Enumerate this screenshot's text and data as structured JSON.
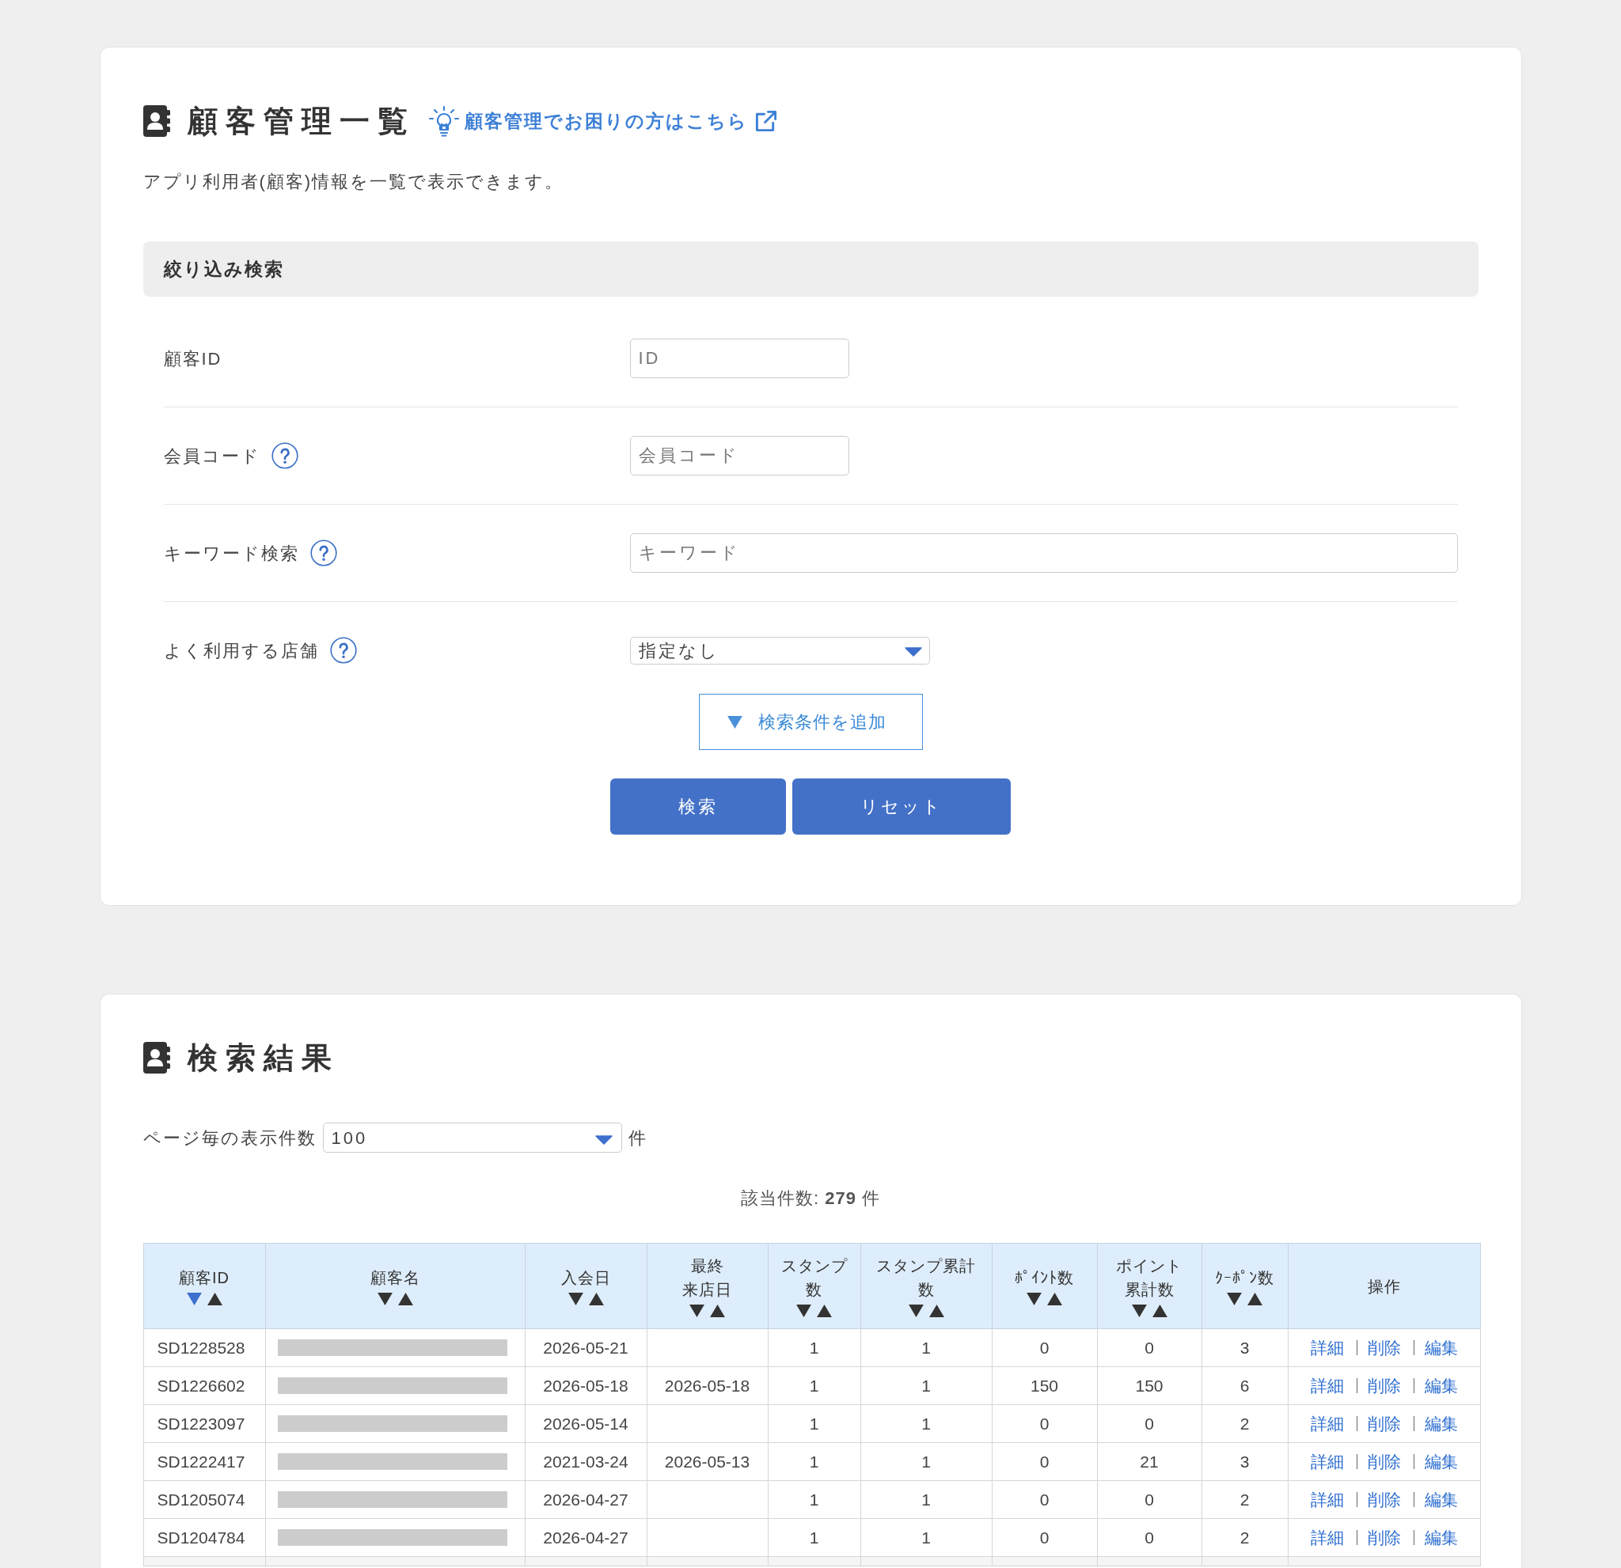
{
  "header": {
    "title": "顧客管理一覧",
    "help_link": "顧客管理でお困りの方はこちら",
    "description": "アプリ利用者(顧客)情報を一覧で表示できます。"
  },
  "filter": {
    "title": "絞り込み検索",
    "fields": [
      {
        "kind": "text",
        "label": "顧客ID",
        "placeholder": "ID",
        "help": false
      },
      {
        "kind": "text",
        "label": "会員コード",
        "placeholder": "会員コード",
        "help": true
      },
      {
        "kind": "search",
        "label": "キーワード検索",
        "placeholder": "キーワード",
        "help": true
      },
      {
        "kind": "select",
        "label": "よく利用する店舗",
        "value": "指定なし",
        "help": true
      }
    ],
    "add_condition": "検索条件を追加",
    "buttons": [
      "検索",
      "リセット"
    ]
  },
  "results": {
    "title": "検索結果",
    "per_page": {
      "label": "ページ毎の表示件数",
      "value": "100",
      "unit": "件"
    },
    "count": "該当件数: **279** 件",
    "table": {
      "columns": [
        {
          "lines": [
            "顧客ID"
          ],
          "sortable": true,
          "sorted_desc": true
        },
        {
          "lines": [
            "顧客名"
          ],
          "sortable": true,
          "sorted_desc": false
        },
        {
          "lines": [
            "入会日"
          ],
          "sortable": true,
          "sorted_desc": false
        },
        {
          "lines": [
            "最終",
            "来店日"
          ],
          "sortable": true,
          "sorted_desc": false
        },
        {
          "lines": [
            "スタンプ",
            "数"
          ],
          "sortable": true,
          "sorted_desc": false
        },
        {
          "lines": [
            "スタンプ累計",
            "数"
          ],
          "sortable": true,
          "sorted_desc": false
        },
        {
          "lines": [
            "ﾎﾟｲﾝﾄ数"
          ],
          "sortable": true,
          "sorted_desc": false
        },
        {
          "lines": [
            "ポイント",
            "累計数"
          ],
          "sortable": true,
          "sorted_desc": false
        },
        {
          "lines": [
            "ｸｰﾎﾟﾝ数"
          ],
          "sortable": true,
          "sorted_desc": false
        },
        {
          "lines": [
            "操作"
          ],
          "sortable": false,
          "sorted_desc": false
        }
      ],
      "rows": [
        {
          "customer_id": "SD1228528",
          "joined": "2026-05-21",
          "stamps": "1",
          "stamps_total": "1",
          "points": "0",
          "points_total": "0",
          "coupons": "3",
          "actions": [
            "詳細",
            "削除",
            "編集"
          ]
        },
        {
          "customer_id": "SD1226602",
          "joined": "2026-05-18",
          "last_visit": "2026-05-18",
          "stamps": "1",
          "stamps_total": "1",
          "points": "150",
          "points_total": "150",
          "coupons": "6",
          "actions": [
            "詳細",
            "削除",
            "編集"
          ]
        },
        {
          "customer_id": "SD1223097",
          "joined": "2026-05-14",
          "stamps": "1",
          "stamps_total": "1",
          "points": "0",
          "points_total": "0",
          "coupons": "2",
          "actions": [
            "詳細",
            "削除",
            "編集"
          ]
        },
        {
          "customer_id": "SD1222417",
          "joined": "2021-03-24",
          "last_visit": "2026-05-13",
          "stamps": "1",
          "stamps_total": "1",
          "points": "0",
          "points_total": "21",
          "coupons": "3",
          "actions": [
            "詳細",
            "削除",
            "編集"
          ]
        },
        {
          "customer_id": "SD1205074",
          "joined": "2026-04-27",
          "stamps": "1",
          "stamps_total": "1",
          "points": "0",
          "points_total": "0",
          "coupons": "2",
          "actions": [
            "詳細",
            "削除",
            "編集"
          ]
        },
        {
          "customer_id": "SD1204784",
          "joined": "2026-04-27",
          "stamps": "1",
          "stamps_total": "1",
          "points": "0",
          "points_total": "0",
          "coupons": "2",
          "actions": [
            "詳細",
            "削除",
            "編集"
          ]
        }
      ]
    }
  }
}
